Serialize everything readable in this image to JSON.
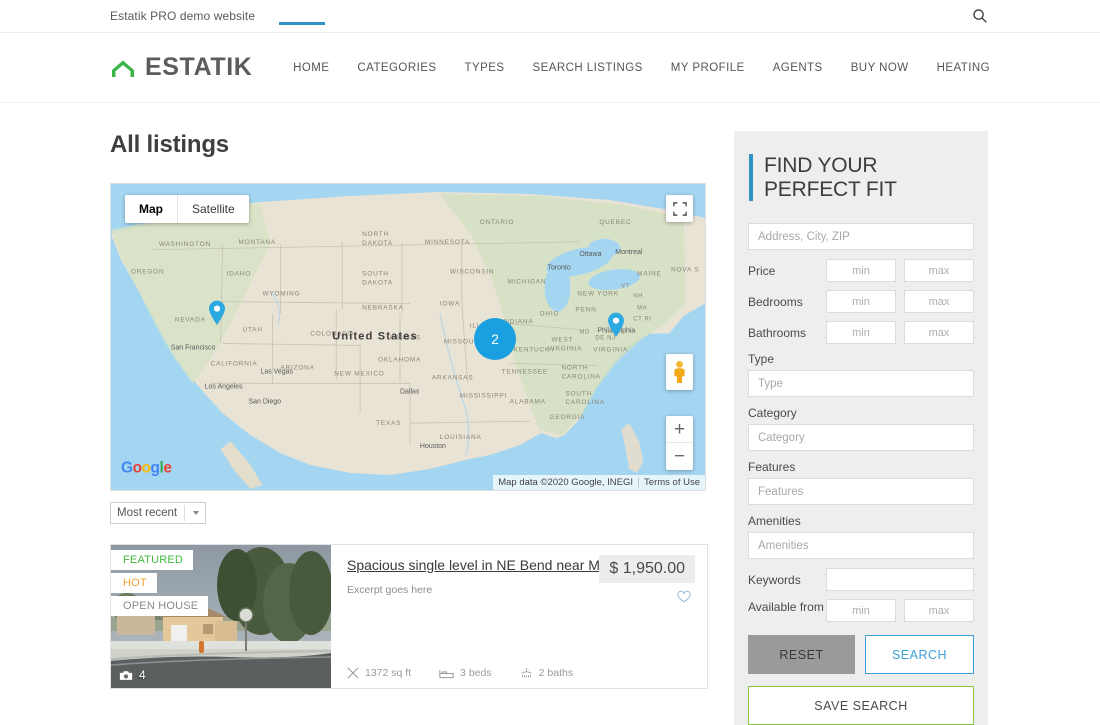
{
  "topbar": {
    "site_note": "Estatik PRO demo website",
    "search_icon": "search-icon"
  },
  "header": {
    "logo_icon": "home-outline-icon",
    "brand": "ESTATIK",
    "nav": [
      {
        "label": "HOME",
        "active": true
      },
      {
        "label": "CATEGORIES",
        "active": false
      },
      {
        "label": "TYPES",
        "active": false
      },
      {
        "label": "SEARCH LISTINGS",
        "active": false
      },
      {
        "label": "MY PROFILE",
        "active": false
      },
      {
        "label": "AGENTS",
        "active": false
      },
      {
        "label": "BUY NOW",
        "active": false
      },
      {
        "label": "HEATING",
        "active": false
      }
    ]
  },
  "main": {
    "page_title": "All listings",
    "map": {
      "type_buttons": [
        {
          "label": "Map",
          "active": true
        },
        {
          "label": "Satellite",
          "active": false
        }
      ],
      "fullscreen_icon": "fullscreen-icon",
      "pegman_icon": "street-view-pegman-icon",
      "zoom_in": "+",
      "zoom_out": "−",
      "cluster_count": "2",
      "google_logo": "Google",
      "attribution": "Map data ©2020 Google, INEGI",
      "terms": "Terms of Use",
      "region_label": "United States",
      "place_labels": [
        "WASHINGTON",
        "MONTANA",
        "NORTH DAKOTA",
        "MINNESOTA",
        "ONTARIO",
        "QUEBEC",
        "OREGON",
        "IDAHO",
        "WYOMING",
        "SOUTH DAKOTA",
        "WISCONSIN",
        "MICHIGAN",
        "Toronto",
        "Ottawa",
        "Montreal",
        "MAINE",
        "NOVA S",
        "NEVADA",
        "UTAH",
        "COLORADO",
        "NEBRASKA",
        "IOWA",
        "ILLINOIS",
        "INDIANA",
        "OHIO",
        "PENN",
        "NEW YORK",
        "VT",
        "NH",
        "MA",
        "CT RI",
        "San Francisco",
        "CALIFORNIA",
        "Las Vegas",
        "Los Angeles",
        "San Diego",
        "ARIZONA",
        "NEW MEXICO",
        "OKLAHOMA",
        "KANSAS",
        "MISSOURI",
        "KENTUCKY",
        "WEST VIRGINIA",
        "VIRGINIA",
        "MD",
        "DE NJ",
        "Philadelphia",
        "TENNESSEE",
        "NORTH CAROLINA",
        "SOUTH CAROLINA",
        "ARKANSAS",
        "MISSISSIPPI",
        "ALABAMA",
        "GEORGIA",
        "TEXAS",
        "LOUISIANA",
        "Dallas",
        "Houston"
      ]
    },
    "sort": {
      "value": "Most recent"
    },
    "listings": [
      {
        "badges": [
          {
            "label": "FEATURED",
            "kind": "featured"
          },
          {
            "label": "HOT",
            "kind": "hot"
          },
          {
            "label": "OPEN HOUSE",
            "kind": "open"
          }
        ],
        "photo_count": "4",
        "photo_icon": "camera-icon",
        "title": "Spacious single level in NE Bend near Mountain View!",
        "excerpt": "Excerpt goes here",
        "price": "$ 1,950.00",
        "favorite_icon": "heart-outline-icon",
        "meta": [
          {
            "icon": "area-icon",
            "value": "1372 sq ft"
          },
          {
            "icon": "bed-icon",
            "value": "3 beds"
          },
          {
            "icon": "bath-icon",
            "value": "2 baths"
          }
        ]
      }
    ]
  },
  "sidebar": {
    "widget_title": "FIND YOUR\nPERFECT FIT",
    "accent_color": "#2f92c4",
    "address_placeholder": "Address, City, ZIP",
    "range_rows": [
      {
        "label": "Price",
        "min_placeholder": "min",
        "max_placeholder": "max"
      },
      {
        "label": "Bedrooms",
        "min_placeholder": "min",
        "max_placeholder": "max"
      },
      {
        "label": "Bathrooms",
        "min_placeholder": "min",
        "max_placeholder": "max"
      }
    ],
    "select_fields": [
      {
        "label": "Type",
        "placeholder": "Type"
      },
      {
        "label": "Category",
        "placeholder": "Category"
      },
      {
        "label": "Features",
        "placeholder": "Features"
      },
      {
        "label": "Amenities",
        "placeholder": "Amenities"
      }
    ],
    "keywords_label": "Keywords",
    "keywords_value": "",
    "available_from_label": "Available from",
    "available_min_placeholder": "min",
    "available_max_placeholder": "max",
    "buttons": {
      "reset": "RESET",
      "search": "SEARCH",
      "save_search": "SAVE SEARCH"
    }
  }
}
